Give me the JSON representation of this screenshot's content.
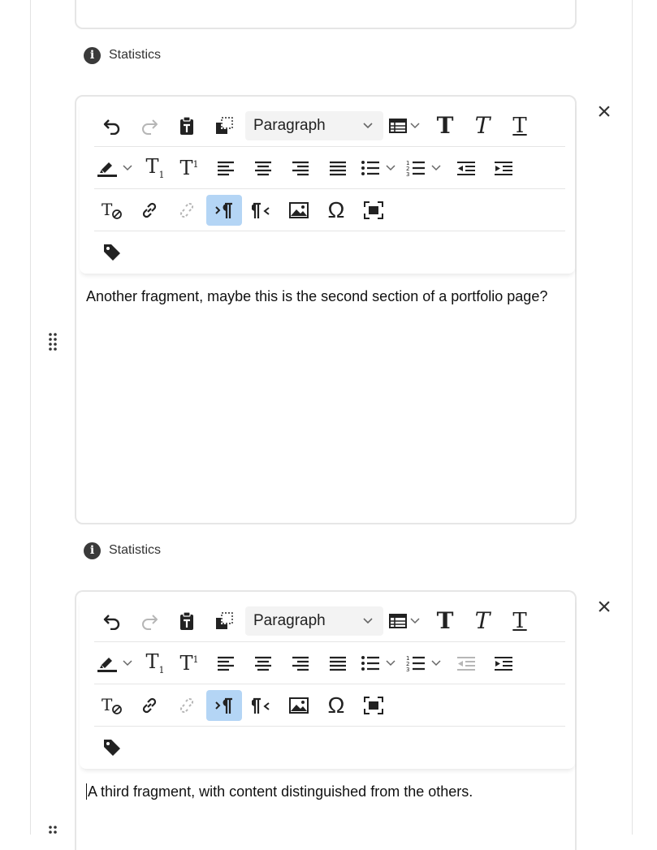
{
  "statistics_label": "Statistics",
  "block_type_label": "Paragraph",
  "close_glyph": "×",
  "editors": [
    {
      "content": "Another fragment, maybe this is the second section of a portfolio page?"
    },
    {
      "content": "A third fragment, with content distinguished from the others."
    }
  ],
  "colors": {
    "active_button": "#b4d5f5",
    "select_bg": "#f3f3f3",
    "border": "#e6e6e6",
    "icon": "#222222"
  },
  "toolbar_icons": [
    [
      "undo-icon",
      "redo-icon",
      "paste-text-icon",
      "paste-from-word-icon",
      "block-format-select",
      "table-icon",
      "bold-icon",
      "italic-icon",
      "underline-icon"
    ],
    [
      "highlight-color-icon",
      "subscript-icon",
      "superscript-icon",
      "align-left-icon",
      "align-center-icon",
      "align-right-icon",
      "justify-icon",
      "bulleted-list-icon",
      "numbered-list-icon",
      "outdent-icon",
      "indent-icon"
    ],
    [
      "remove-format-icon",
      "link-icon",
      "unlink-icon",
      "ltr-direction-icon",
      "rtl-direction-icon",
      "image-icon",
      "special-char-icon",
      "fullscreen-icon"
    ],
    [
      "tag-icon"
    ]
  ]
}
